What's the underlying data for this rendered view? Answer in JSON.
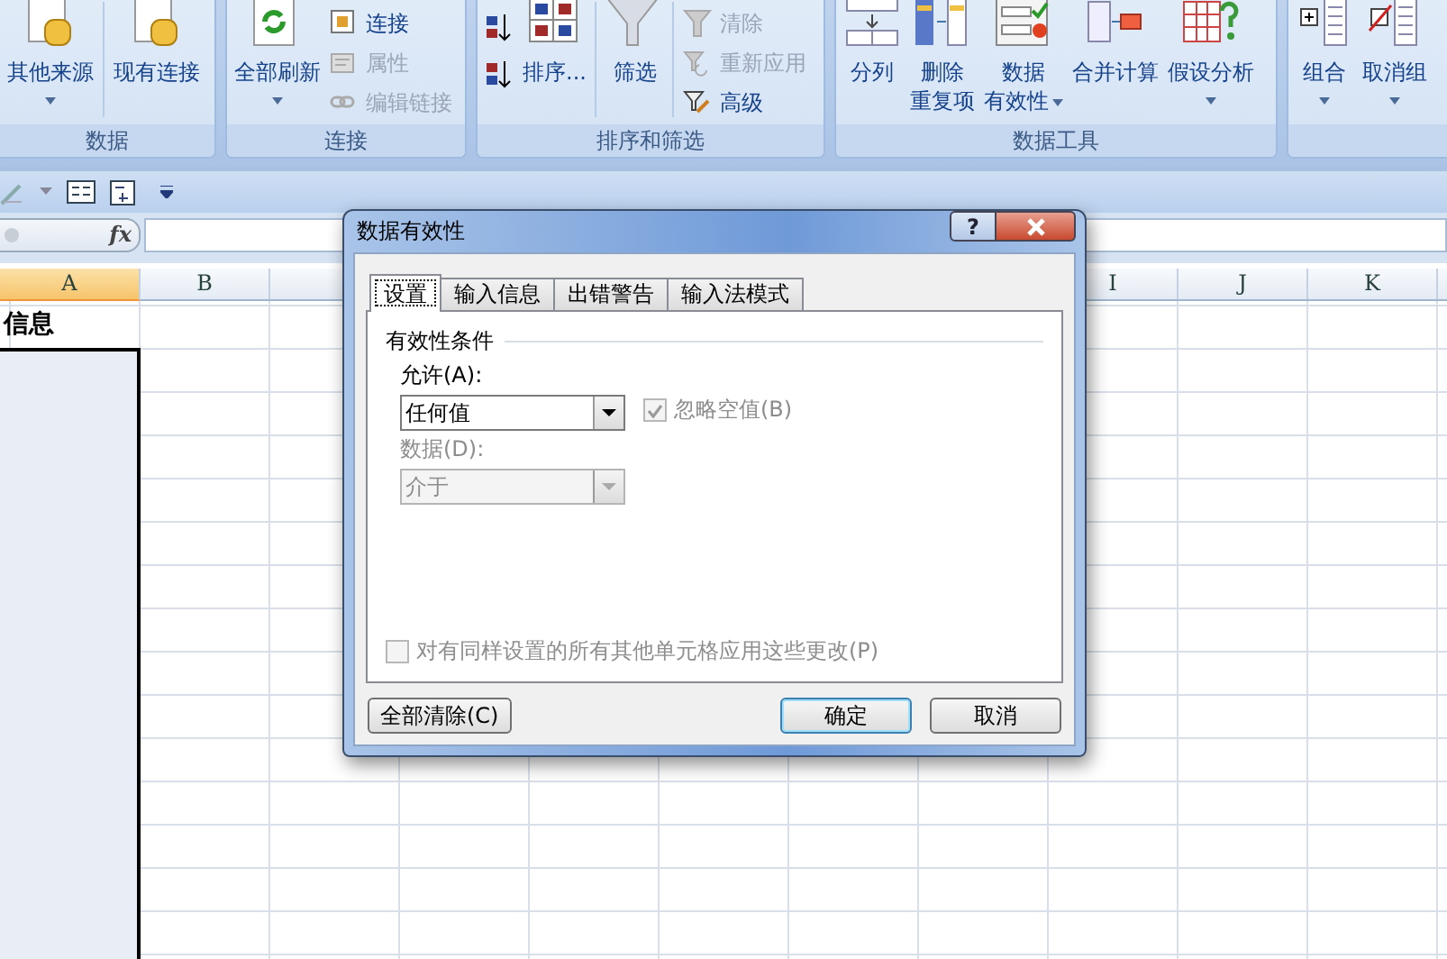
{
  "ribbon": {
    "groups": [
      {
        "label": "数据",
        "items": [
          {
            "kind": "large",
            "label": "其他来源",
            "dropdown": true
          },
          {
            "kind": "large",
            "label": "现有连接",
            "dropdown": false
          }
        ]
      },
      {
        "label": "连接",
        "items": [
          {
            "kind": "large",
            "label": "全部刷新",
            "dropdown": true
          },
          {
            "kind": "stack",
            "buttons": [
              {
                "kind": "text",
                "label": "连接",
                "disabled": false
              },
              {
                "kind": "text",
                "label": "属性",
                "disabled": true
              },
              {
                "kind": "text",
                "label": "编辑链接",
                "disabled": true
              }
            ]
          }
        ]
      },
      {
        "label": "排序和筛选",
        "items": [
          {
            "kind": "stack",
            "buttons": [
              {
                "kind": "icon"
              },
              {
                "kind": "icon"
              }
            ]
          },
          {
            "kind": "large",
            "label": "排序...",
            "dropdown": false
          },
          {
            "kind": "large",
            "label": "筛选",
            "dropdown": false
          },
          {
            "kind": "stack",
            "buttons": [
              {
                "kind": "text",
                "label": "清除",
                "disabled": true
              },
              {
                "kind": "text",
                "label": "重新应用",
                "disabled": true
              },
              {
                "kind": "text",
                "label": "高级",
                "disabled": false
              }
            ]
          }
        ]
      },
      {
        "label": "数据工具",
        "items": [
          {
            "kind": "large",
            "label": "分列",
            "dropdown": false
          },
          {
            "kind": "large",
            "label": "删除",
            "label_2": "重复项",
            "dropdown": false
          },
          {
            "kind": "large",
            "label": "数据",
            "label_2": "有效性",
            "dropdown": true
          },
          {
            "kind": "large",
            "label": "合并计算",
            "dropdown": false
          },
          {
            "kind": "large",
            "label": "假设分析",
            "dropdown": true
          }
        ]
      },
      {
        "items": [
          {
            "kind": "large",
            "label": "组合",
            "dropdown": true
          },
          {
            "kind": "large",
            "label": "取消组",
            "dropdown": true
          }
        ]
      }
    ]
  },
  "formula_bar": {
    "fx": "fx"
  },
  "sheet": {
    "columns": [
      {
        "kind": "header",
        "label": "A",
        "selected": true
      },
      {
        "kind": "header",
        "label": "B",
        "selected": false
      },
      {
        "kind": "covered"
      },
      {
        "kind": "covered"
      },
      {
        "kind": "covered"
      },
      {
        "kind": "covered"
      },
      {
        "kind": "covered"
      },
      {
        "kind": "covered"
      },
      {
        "kind": "header",
        "label": "I",
        "selected": false
      },
      {
        "kind": "header",
        "label": "J",
        "selected": false
      },
      {
        "kind": "header",
        "label": "K",
        "selected": false
      }
    ],
    "a1": "信息",
    "range_selected": true
  },
  "dialog": {
    "title": "数据有效性",
    "help": "?",
    "tabs": [
      {
        "label": "设置",
        "selected": true
      },
      {
        "label": "输入信息",
        "selected": false
      },
      {
        "label": "出错警告",
        "selected": false
      },
      {
        "label": "输入法模式",
        "selected": false
      }
    ],
    "section": "有效性条件",
    "allow": {
      "label": "允许(A):",
      "value": "任何值",
      "disabled": false
    },
    "ignore_blank": {
      "label": "忽略空值(B)",
      "checked": true,
      "disabled": true
    },
    "data": {
      "label": "数据(D):",
      "value": "介于",
      "disabled": true
    },
    "apply_all": {
      "label": "对有同样设置的所有其他单元格应用这些更改(P)",
      "checked": false,
      "disabled": true
    },
    "buttons": [
      {
        "label": "全部清除(C)",
        "default": false
      },
      {
        "label": "确定",
        "default": true
      },
      {
        "label": "取消",
        "default": false
      }
    ]
  }
}
